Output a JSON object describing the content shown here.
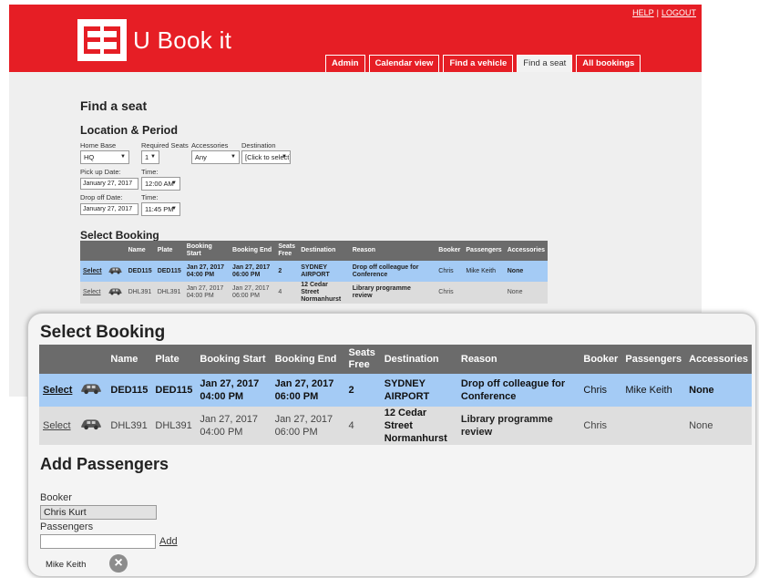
{
  "app": {
    "name": "U Book it",
    "brand_color": "#e61e25"
  },
  "top_links": {
    "help": "HELP",
    "separator": "|",
    "logout": "LOGOUT"
  },
  "nav_tabs": [
    {
      "label": "Admin",
      "active": false
    },
    {
      "label": "Calendar view",
      "active": false
    },
    {
      "label": "Find a vehicle",
      "active": false
    },
    {
      "label": "Find a seat",
      "active": true
    },
    {
      "label": "All bookings",
      "active": false
    }
  ],
  "page": {
    "title": "Find a seat",
    "location_section": "Location & Period",
    "select_booking_section": "Select Booking",
    "add_passengers_section": "Add Passengers"
  },
  "form": {
    "home_base": {
      "label": "Home Base",
      "value": "HQ"
    },
    "required_seats": {
      "label": "Required Seats",
      "value": "1"
    },
    "accessories": {
      "label": "Accessories",
      "value": "Any"
    },
    "destination": {
      "label": "Destination",
      "value": "[Click to select]"
    },
    "pickup_date": {
      "label": "Pick up Date:",
      "value": "January 27, 2017"
    },
    "pickup_time": {
      "label": "Time:",
      "value": "12:00 AM"
    },
    "dropoff_date": {
      "label": "Drop off Date:",
      "value": "January 27, 2017"
    },
    "dropoff_time": {
      "label": "Time:",
      "value": "11:45 PM"
    }
  },
  "bookings_table": {
    "columns": [
      "",
      "",
      "Name",
      "Plate",
      "Booking Start",
      "Booking End",
      "Seats Free",
      "Destination",
      "Reason",
      "Booker",
      "Passengers",
      "Accessories"
    ],
    "select_label": "Select",
    "car_icon": "car-icon",
    "rows": [
      {
        "highlighted": true,
        "name": "DED115",
        "plate": "DED115",
        "start_date": "Jan 27, 2017",
        "start_time": "04:00 PM",
        "end_date": "Jan 27, 2017",
        "end_time": "06:00 PM",
        "seats_free": "2",
        "destination_1": "SYDNEY",
        "destination_2": "AIRPORT",
        "reason_1": "Drop off colleague for",
        "reason_2": "Conference",
        "booker": "Chris",
        "passengers": "Mike Keith",
        "accessories": "None"
      },
      {
        "highlighted": false,
        "name": "DHL391",
        "plate": "DHL391",
        "start_date": "Jan 27, 2017",
        "start_time": "04:00 PM",
        "end_date": "Jan 27, 2017",
        "end_time": "06:00 PM",
        "seats_free": "4",
        "destination_1": "12 Cedar Street",
        "destination_2": "Normanhurst",
        "reason_1": "Library programme",
        "reason_2": "review",
        "booker": "Chris",
        "passengers": "",
        "accessories": "None"
      }
    ]
  },
  "passengers_form": {
    "booker_label": "Booker",
    "booker_value": "Chris Kurt",
    "passengers_label": "Passengers",
    "add_label": "Add",
    "added_passenger": "Mike Keith",
    "remove_icon": "close-icon"
  },
  "colors": {
    "header_bg": "#6b6b6b",
    "selected_row": "#a4cbf5",
    "row_bg": "#dcdcdc"
  }
}
